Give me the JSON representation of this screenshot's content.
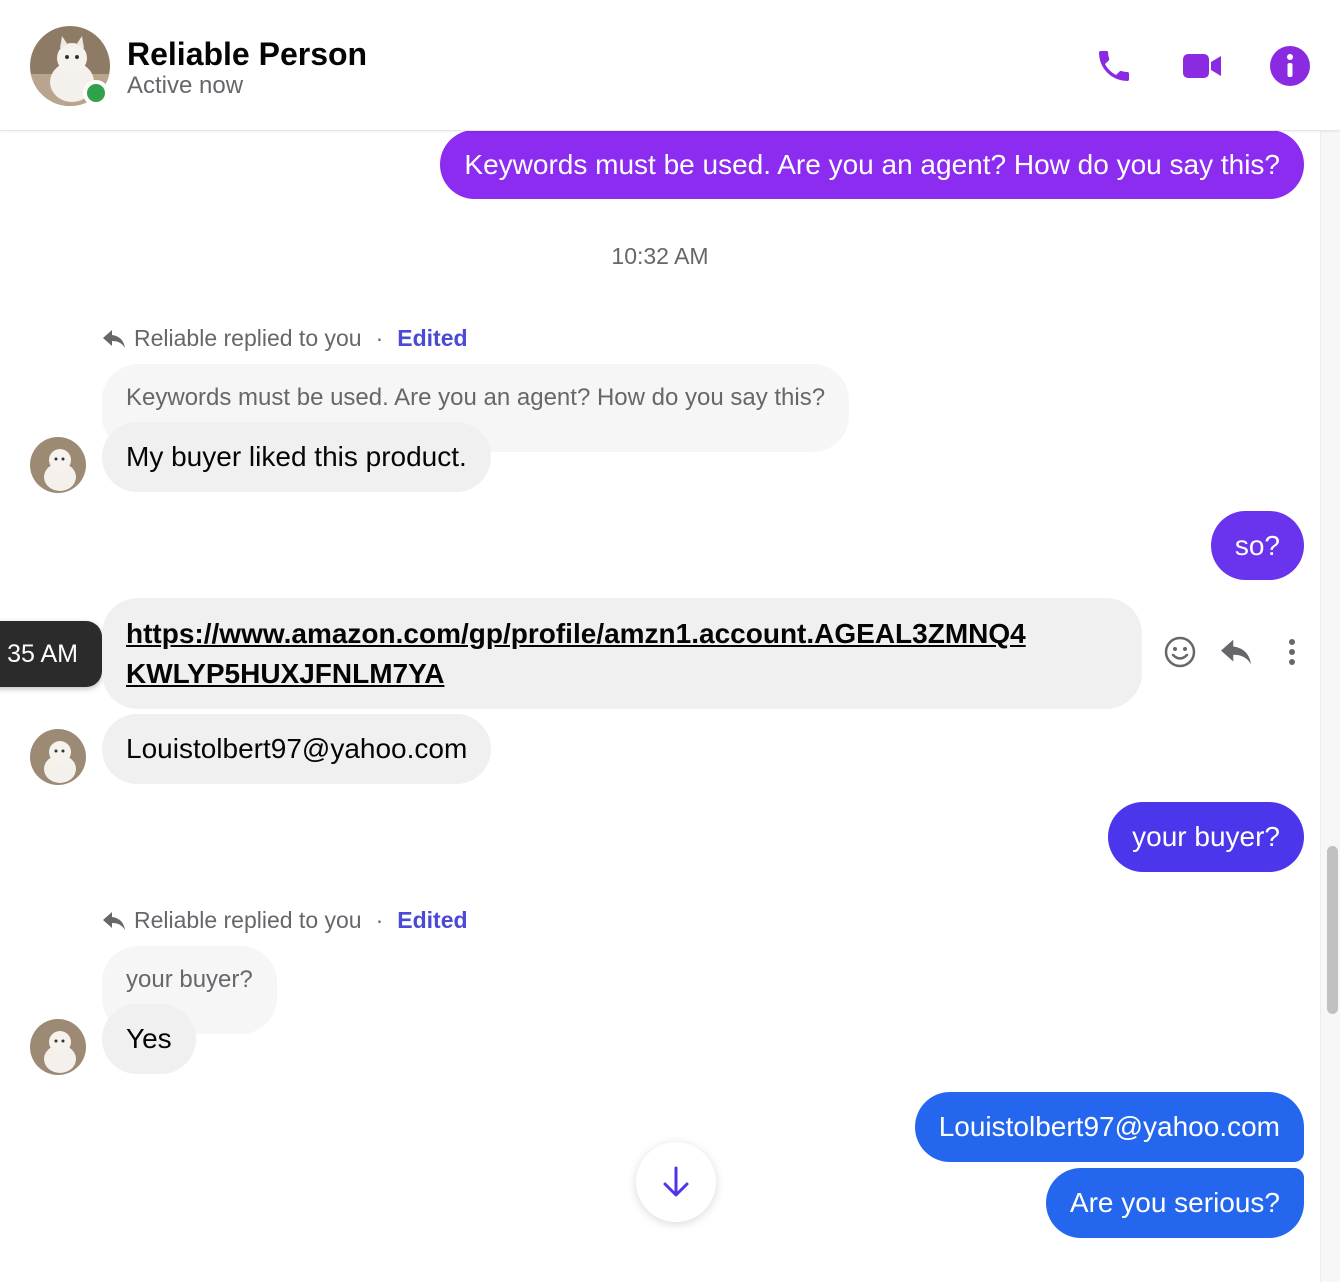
{
  "header": {
    "contact_name": "Reliable Person",
    "status": "Active now",
    "icons": [
      "phone-icon",
      "video-camera-icon",
      "info-icon"
    ]
  },
  "colors": {
    "accent": "#8a2be2",
    "outgoing_purple": "#8b2cf0",
    "outgoing_indigo": "#4b36ec",
    "outgoing_blue": "#2467ee",
    "incoming_bg": "#f0f0f0",
    "edited": "#4a4ad6",
    "online": "#31a24c"
  },
  "messages": {
    "out_1": "Keywords must be used. Are you an agent? How do you say this?",
    "timestamp_1": "10:32 AM",
    "reply_1": {
      "label": "Reliable replied to you",
      "dot": "·",
      "edited": "Edited",
      "quoted": "Keywords must be used. Are you an agent? How do you say this?",
      "text": "My buyer liked this product."
    },
    "out_2": "so?",
    "tooltip_time": "35 AM",
    "link": {
      "line1": "https://www.amazon.com/gp/profile/amzn1.account.AGEAL3ZMNQ4",
      "line2": "KWLYP5HUXJFNLM7YA"
    },
    "in_email": "Louistolbert97@yahoo.com",
    "out_3": "your buyer?",
    "reply_2": {
      "label": "Reliable replied to you",
      "dot": "·",
      "edited": "Edited",
      "quoted": "your buyer?",
      "text": "Yes"
    },
    "out_4": "Louistolbert97@yahoo.com",
    "out_5": "Are you serious?"
  },
  "message_actions": [
    "emoji-react-icon",
    "reply-icon",
    "more-options-icon"
  ],
  "scroll_down_icon": "arrow-down-icon"
}
